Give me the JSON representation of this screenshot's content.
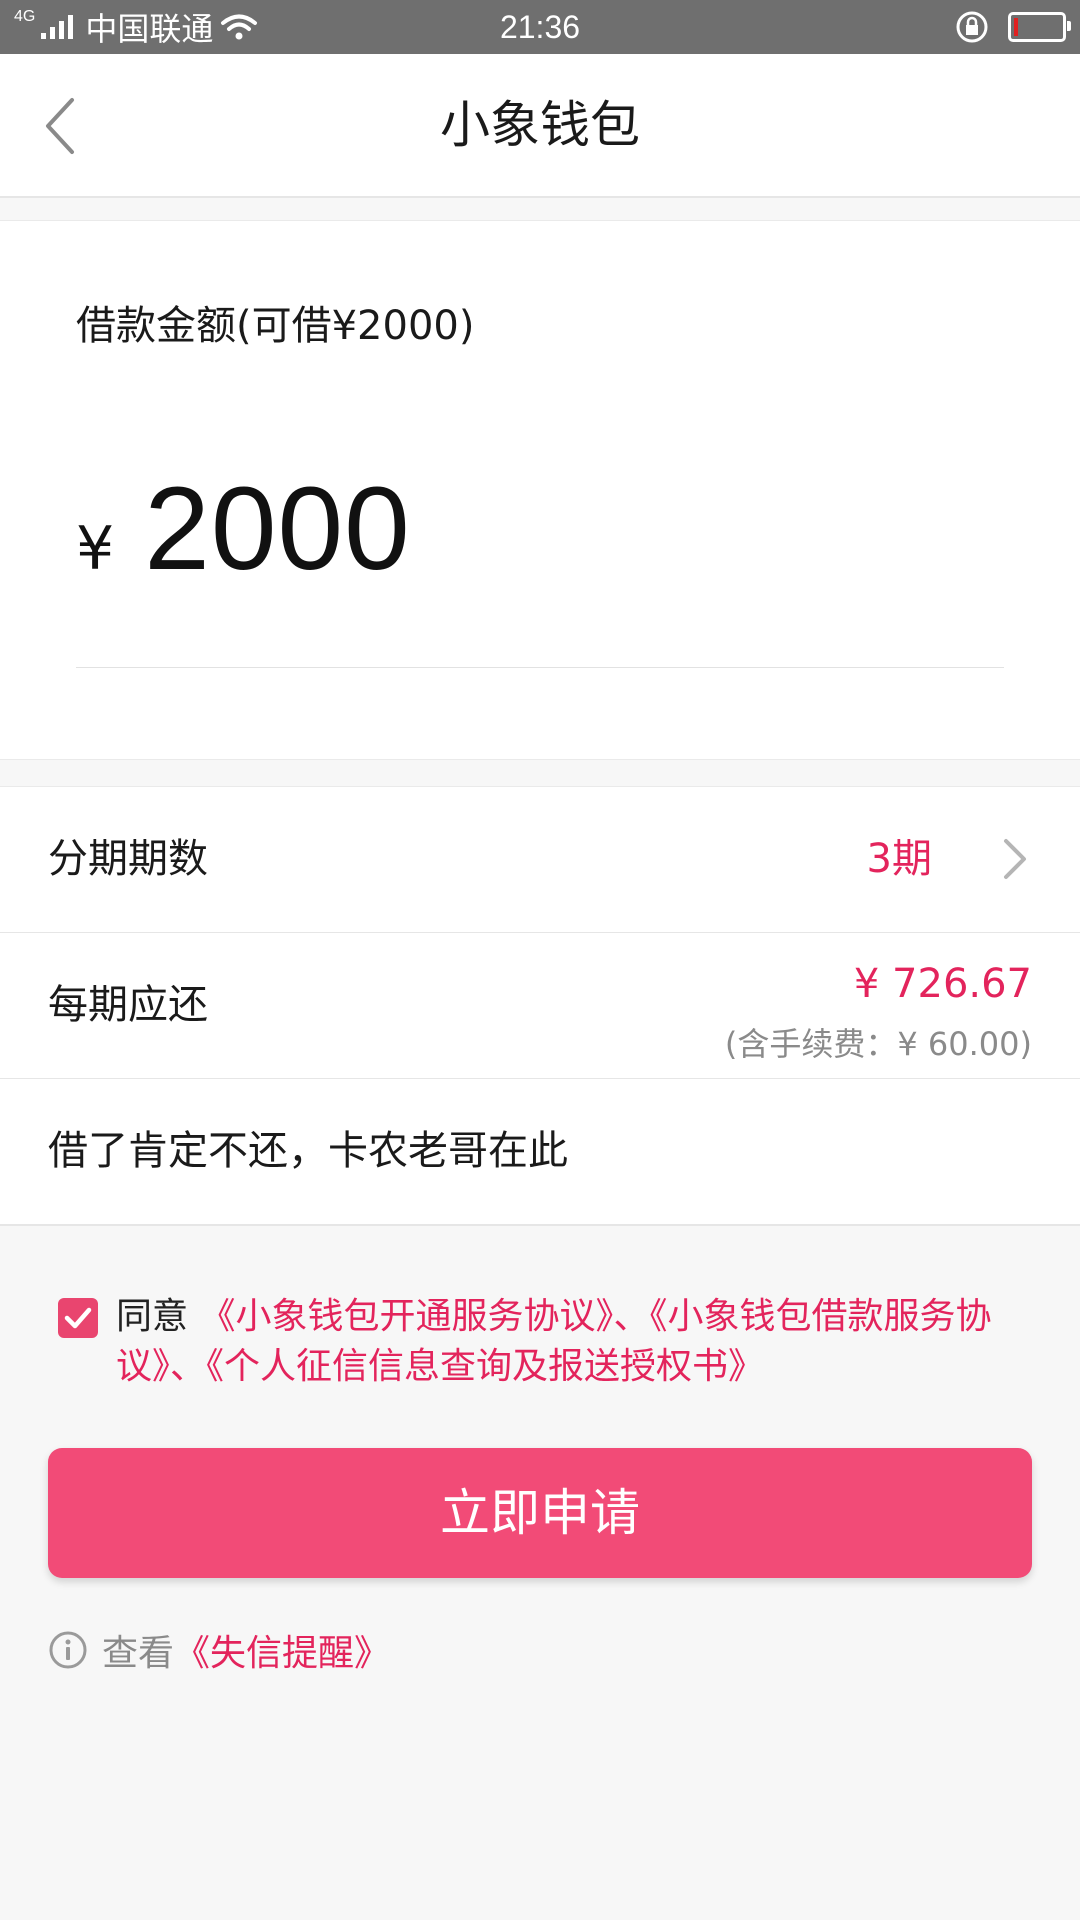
{
  "status_bar": {
    "network": "4G",
    "carrier": "中国联通",
    "time": "21:36"
  },
  "header": {
    "title": "小象钱包"
  },
  "loan": {
    "amount_label": "借款金额(可借¥2000)",
    "currency_symbol": "¥",
    "amount_value": "2000"
  },
  "installment": {
    "label": "分期期数",
    "value": "3期"
  },
  "per_period": {
    "label": "每期应还",
    "value": "¥ 726.67",
    "fee_note": "(含手续费：¥ 60.00)"
  },
  "purpose": {
    "text": "借了肯定不还，卡农老哥在此"
  },
  "agreement": {
    "checked": true,
    "prefix": "同意 ",
    "links_text": "《小象钱包开通服务协议》、《小象钱包借款服务协议》、《个人征信信息查询及报送授权书》"
  },
  "apply_button": {
    "label": "立即申请"
  },
  "notice": {
    "prefix": "查看",
    "link": "《失信提醒》"
  },
  "colors": {
    "accent": "#e3245c",
    "button": "#f24b77",
    "status_bar": "#6f6f6f"
  }
}
